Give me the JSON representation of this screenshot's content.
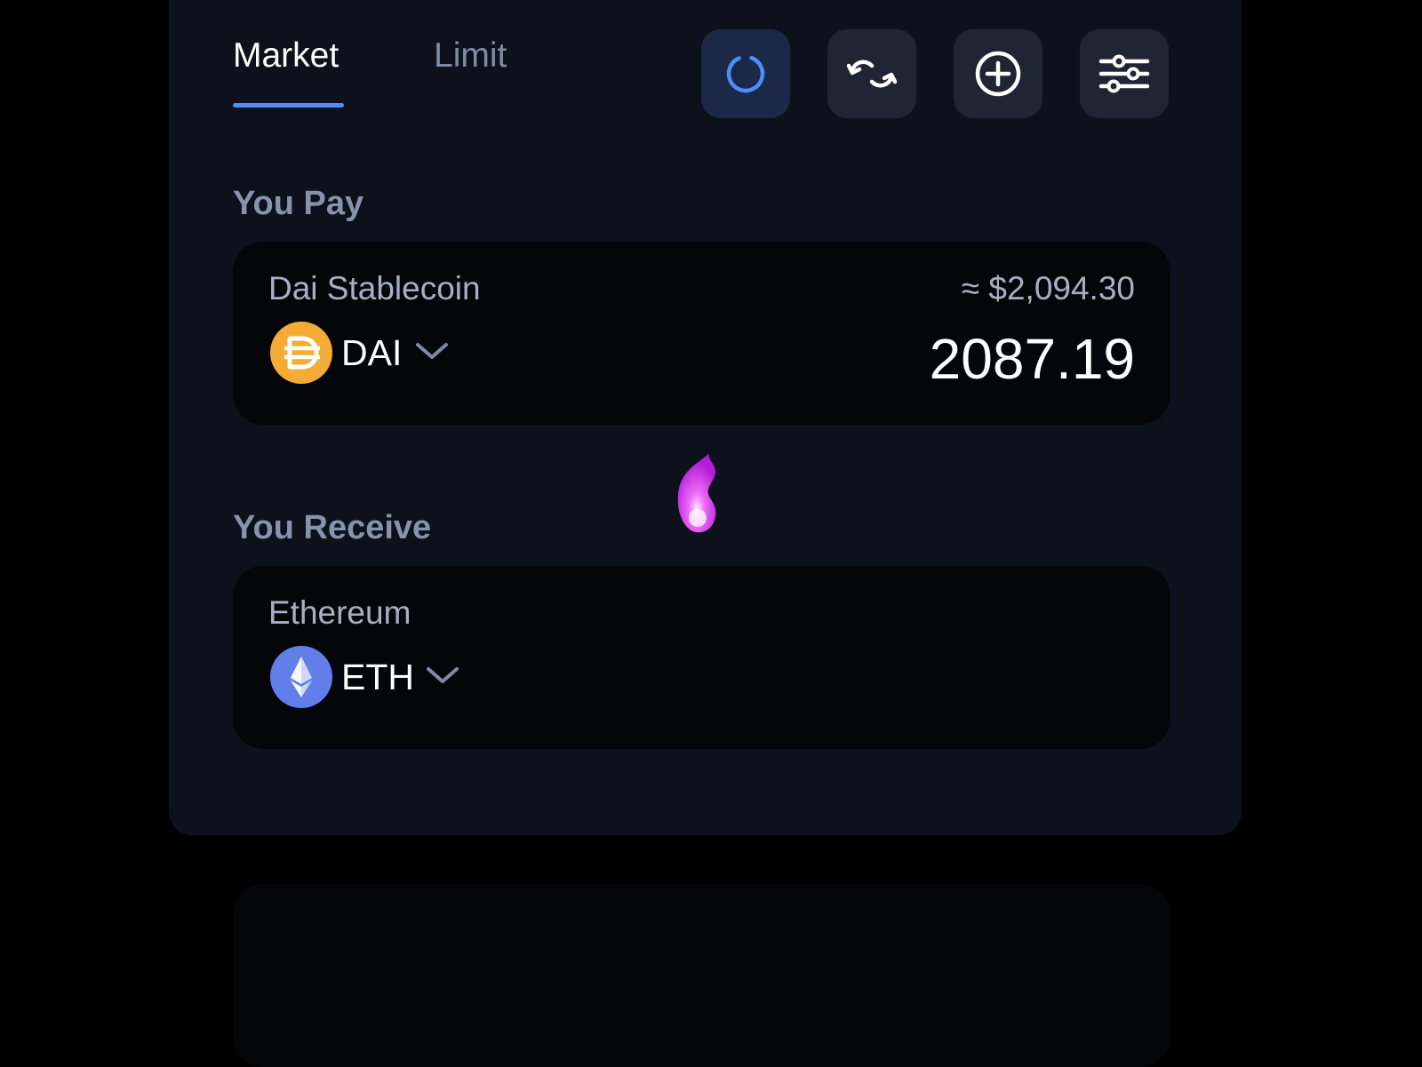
{
  "tabs": {
    "market": "Market",
    "limit": "Limit",
    "active": "Market"
  },
  "toolbar": {
    "refresh_icon": "refresh-icon",
    "swap_icon": "swap-arrows-icon",
    "add_icon": "plus-circle-icon",
    "settings_icon": "sliders-icon"
  },
  "pay": {
    "label": "You Pay",
    "token_name": "Dai Stablecoin",
    "symbol": "DAI",
    "usd_value": "≈ $2,094.30",
    "amount": "2087.19",
    "icon": "dai-icon",
    "icon_color": "#f5ac37"
  },
  "receive": {
    "label": "You Receive",
    "token_name": "Ethereum",
    "symbol": "ETH",
    "icon": "eth-icon",
    "icon_color": "#627eea"
  },
  "colors": {
    "accent": "#4d8df5",
    "panel": "#0d111b",
    "card": "#050609",
    "muted_text": "#8793ab",
    "flame": "#d63cf0"
  }
}
